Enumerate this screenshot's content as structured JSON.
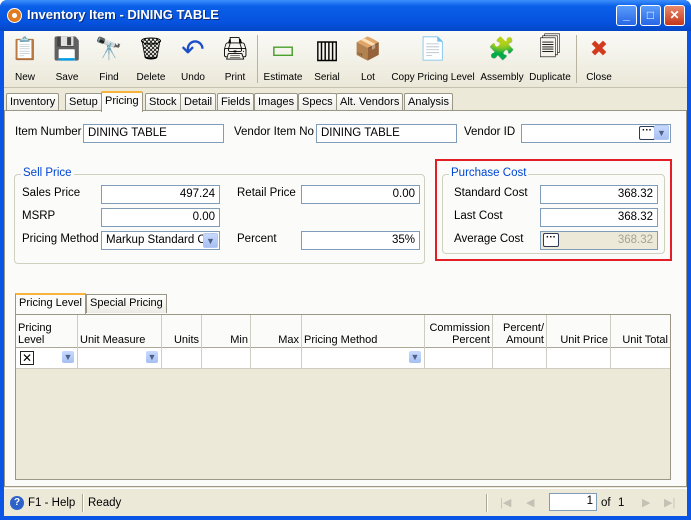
{
  "window": {
    "title": "Inventory Item - DINING TABLE",
    "controls": {
      "minimize": "_",
      "maximize": "□",
      "close": "✕"
    }
  },
  "toolbar": {
    "items": [
      {
        "label": "New",
        "icon": "new-document-icon",
        "glyph": "📋"
      },
      {
        "label": "Save",
        "icon": "save-disk-icon",
        "glyph": "💾"
      },
      {
        "label": "Find",
        "icon": "binoculars-icon",
        "glyph": "🔭"
      },
      {
        "label": "Delete",
        "icon": "recycle-bin-icon",
        "glyph": "🗑"
      },
      {
        "label": "Undo",
        "icon": "undo-arrow-icon",
        "glyph": "↶"
      },
      {
        "label": "Print",
        "icon": "printer-icon",
        "glyph": "🖨"
      },
      {
        "label": "Estimate",
        "icon": "estimate-icon",
        "glyph": "▭"
      },
      {
        "label": "Serial",
        "icon": "barcode-icon",
        "glyph": "▥"
      },
      {
        "label": "Lot",
        "icon": "boxes-icon",
        "glyph": "📦"
      },
      {
        "label": "Copy Pricing Level",
        "icon": "copy-pricing-icon",
        "glyph": "📄"
      },
      {
        "label": "Assembly",
        "icon": "assembly-icon",
        "glyph": "🧩"
      },
      {
        "label": "Duplicate",
        "icon": "duplicate-icon",
        "glyph": "🗐"
      },
      {
        "label": "Close",
        "icon": "close-window-icon",
        "glyph": "✖"
      }
    ]
  },
  "tabs": [
    "Inventory",
    "Setup",
    "Pricing",
    "Stock",
    "Detail",
    "Fields",
    "Images",
    "Specs",
    "Alt. Vendors",
    "Analysis"
  ],
  "active_tab": "Pricing",
  "header": {
    "item_number_label": "Item Number",
    "item_number_value": "DINING TABLE",
    "vendor_item_no_label": "Vendor Item No",
    "vendor_item_no_value": "DINING TABLE",
    "vendor_id_label": "Vendor ID",
    "vendor_id_value": ""
  },
  "sell_price": {
    "title": "Sell Price",
    "sales_price_label": "Sales Price",
    "sales_price_value": "497.24",
    "retail_price_label": "Retail Price",
    "retail_price_value": "0.00",
    "msrp_label": "MSRP",
    "msrp_value": "0.00",
    "pricing_method_label": "Pricing Method",
    "pricing_method_value": "Markup Standard C",
    "percent_label": "Percent",
    "percent_value": "35%"
  },
  "purchase_cost": {
    "title": "Purchase Cost",
    "standard_cost_label": "Standard Cost",
    "standard_cost_value": "368.32",
    "last_cost_label": "Last Cost",
    "last_cost_value": "368.32",
    "average_cost_label": "Average Cost",
    "average_cost_value": "368.32"
  },
  "subtabs": [
    "Pricing Level",
    "Special Pricing"
  ],
  "grid": {
    "headers": {
      "pricing_level": "Pricing Level",
      "unit_measure": "Unit Measure",
      "units": "Units",
      "min": "Min",
      "max": "Max",
      "pricing_method": "Pricing Method",
      "commission_percent": "Commission Percent",
      "percent_amount": "Percent/ Amount",
      "unit_price": "Unit Price",
      "unit_total": "Unit Total"
    }
  },
  "status": {
    "help": "F1 - Help",
    "state": "Ready",
    "page_current": "1",
    "page_of": "of",
    "page_total": "1"
  },
  "colors": {
    "title_bar": "#0a54e6",
    "group_title": "#0046d5",
    "highlight_box": "#e31e24",
    "active_tab_accent": "#f8b33c"
  }
}
